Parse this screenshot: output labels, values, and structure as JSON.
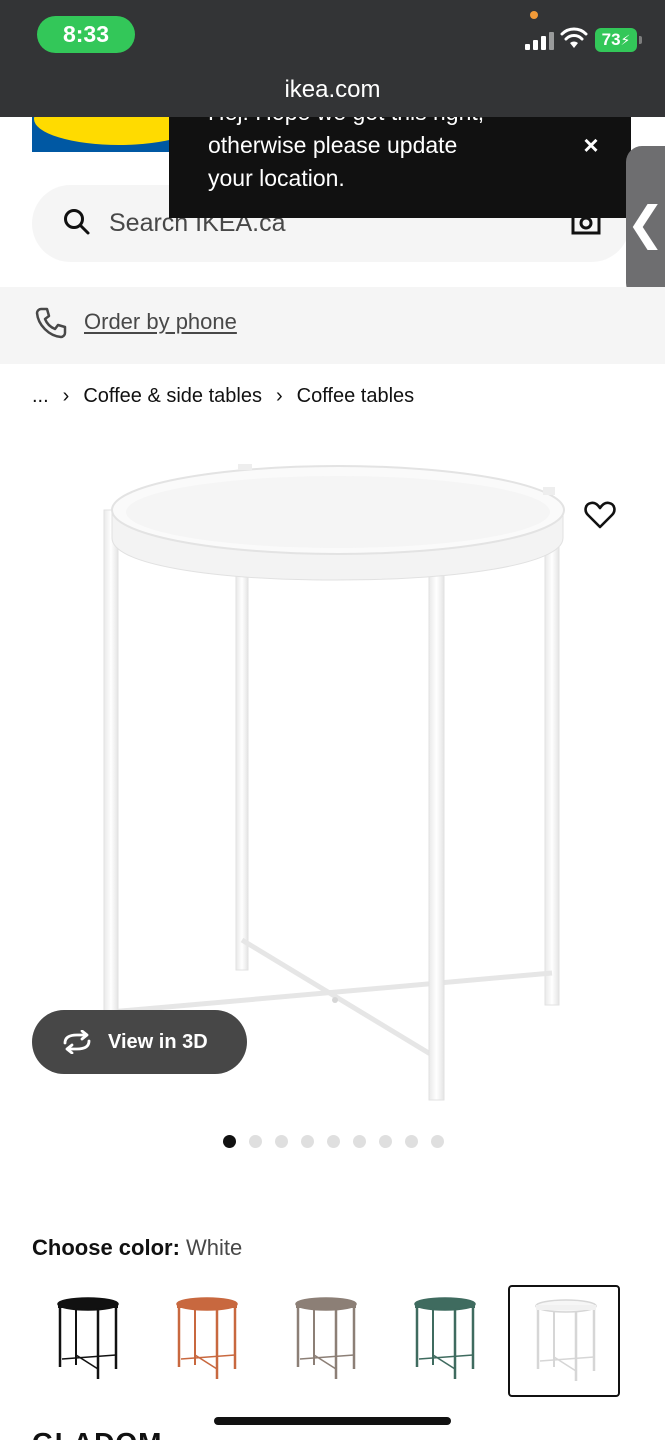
{
  "status_bar": {
    "time": "8:33",
    "battery": "73"
  },
  "browser": {
    "url": "ikea.com"
  },
  "toast": {
    "line1": "Hej! Hope we got this right,",
    "line2": "otherwise please update",
    "line3": "your location.",
    "close_label": "×"
  },
  "side_tab": {
    "label": "❮"
  },
  "search": {
    "placeholder": "Search IKEA.ca"
  },
  "order_by_phone": {
    "label": "Order by phone"
  },
  "breadcrumb": {
    "ellipsis": "...",
    "separator": "›",
    "items": [
      "Coffee & side tables",
      "Coffee tables"
    ]
  },
  "gallery": {
    "view_3d_label": "View in 3D",
    "image_count": 9,
    "active_index": 0
  },
  "color_picker": {
    "label": "Choose color:",
    "selected": "White",
    "options": [
      {
        "color": "#111111"
      },
      {
        "color": "#c8683f"
      },
      {
        "color": "#8c7f76"
      },
      {
        "color": "#3f6b5f"
      },
      {
        "color": "#dedede"
      }
    ],
    "selected_index": 4
  },
  "product": {
    "name_peek": "GLADOM"
  },
  "colors": {
    "status_bar_bg": "#333436",
    "status_green": "#33c759",
    "ikea_blue": "#0058a3",
    "ikea_yellow": "#ffdb00"
  },
  "icons": [
    "search-icon",
    "camera-icon",
    "phone-icon",
    "heart-icon",
    "rotate-3d-icon",
    "close-icon",
    "chevron-left-icon"
  ]
}
